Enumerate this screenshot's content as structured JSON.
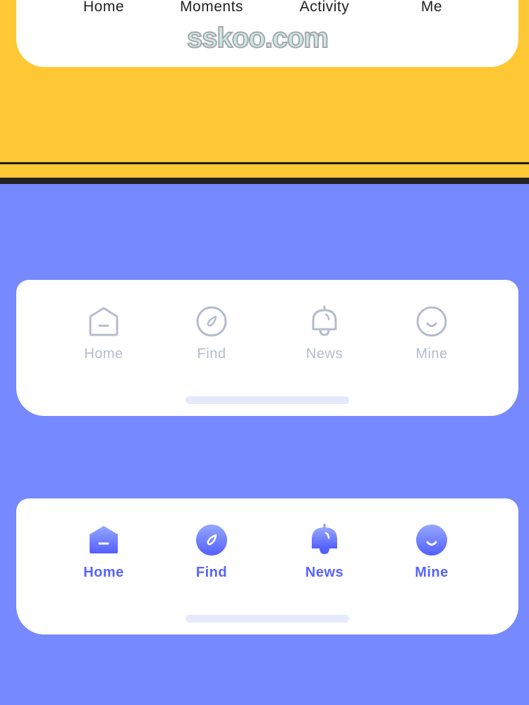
{
  "colors": {
    "yellow_bg": "#fec834",
    "blue_bg": "#7789fe",
    "inactive": "#b4bcce",
    "active": "#5864fd"
  },
  "top_bar": {
    "tabs": [
      {
        "label": "Home"
      },
      {
        "label": "Moments"
      },
      {
        "label": "Activity"
      },
      {
        "label": "Me"
      }
    ]
  },
  "watermark": "sskoo.com",
  "inactive_bar": {
    "tabs": [
      {
        "label": "Home",
        "icon": "home-icon"
      },
      {
        "label": "Find",
        "icon": "compass-icon"
      },
      {
        "label": "News",
        "icon": "bell-icon"
      },
      {
        "label": "Mine",
        "icon": "smile-icon"
      }
    ]
  },
  "active_bar": {
    "tabs": [
      {
        "label": "Home",
        "icon": "home-icon"
      },
      {
        "label": "Find",
        "icon": "compass-icon"
      },
      {
        "label": "News",
        "icon": "bell-icon"
      },
      {
        "label": "Mine",
        "icon": "smile-icon"
      }
    ]
  }
}
